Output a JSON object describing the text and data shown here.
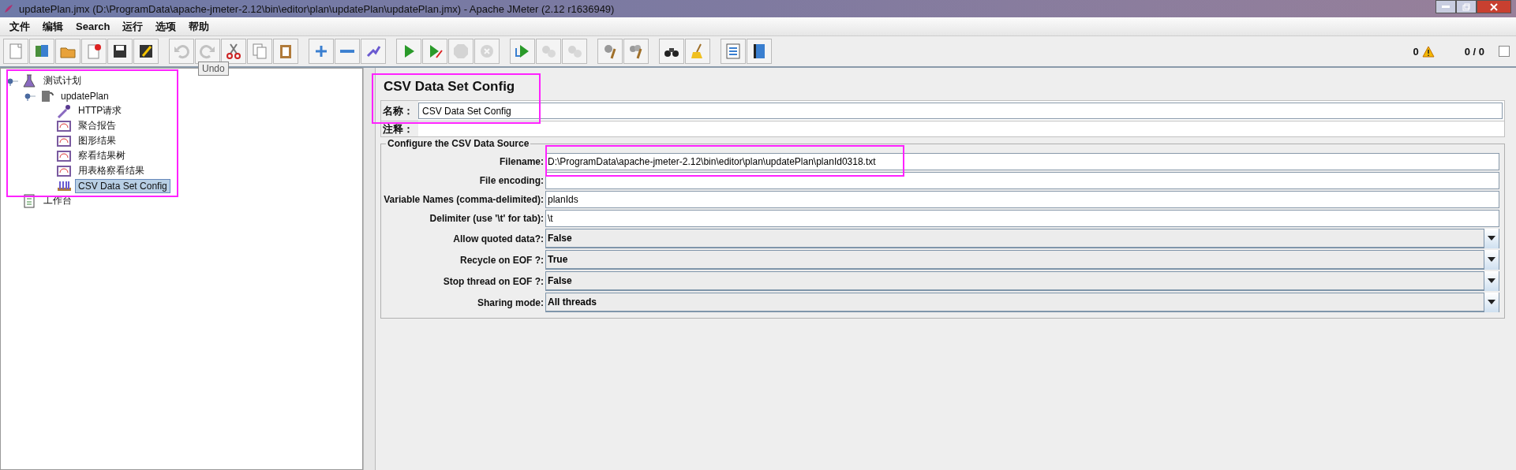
{
  "window": {
    "title": "updatePlan.jmx (D:\\ProgramData\\apache-jmeter-2.12\\bin\\editor\\plan\\updatePlan\\updatePlan.jmx) - Apache JMeter (2.12 r1636949)"
  },
  "menu": [
    "文件",
    "编辑",
    "Search",
    "运行",
    "选项",
    "帮助"
  ],
  "toolbar": [
    [
      {
        "disabled": false
      },
      {
        "disabled": false
      },
      {
        "disabled": false
      },
      {
        "disabled": false
      },
      {
        "disabled": false
      },
      {
        "disabled": false
      }
    ],
    [
      {
        "disabled": true
      },
      {
        "disabled": true
      },
      {
        "disabled": false
      },
      {
        "disabled": false
      },
      {
        "disabled": false
      }
    ],
    [
      {
        "disabled": false
      },
      {
        "disabled": false
      },
      {
        "disabled": false
      }
    ],
    [
      {
        "disabled": false
      },
      {
        "disabled": false
      },
      {
        "disabled": true
      },
      {
        "disabled": true
      }
    ],
    [
      {
        "disabled": false
      },
      {
        "disabled": true
      },
      {
        "disabled": true
      }
    ],
    [
      {
        "disabled": false
      },
      {
        "disabled": false
      }
    ],
    [
      {
        "disabled": false
      },
      {
        "disabled": false
      }
    ],
    [
      {
        "disabled": false
      },
      {
        "disabled": false
      }
    ]
  ],
  "tooltip": "Undo",
  "status": {
    "errors": "0",
    "threads": "0 / 0"
  },
  "tree": [
    {
      "label": "测试计划",
      "kind": "plan",
      "selected": false,
      "expanded": true,
      "children": [
        {
          "label": "updatePlan",
          "kind": "group",
          "selected": false,
          "expanded": true,
          "children": [
            {
              "label": "HTTP请求",
              "kind": "sampler",
              "selected": false
            },
            {
              "label": "聚合报告",
              "kind": "listener",
              "selected": false
            },
            {
              "label": "图形结果",
              "kind": "listener",
              "selected": false
            },
            {
              "label": "察看结果树",
              "kind": "listener",
              "selected": false
            },
            {
              "label": "用表格察看结果",
              "kind": "listener",
              "selected": false
            },
            {
              "label": "CSV Data Set Config",
              "kind": "config",
              "selected": true
            }
          ]
        }
      ]
    },
    {
      "label": "工作台",
      "kind": "workbench",
      "selected": false
    }
  ],
  "form": {
    "title": "CSV Data Set Config",
    "name_label": "名称：",
    "name_value": "CSV Data Set Config",
    "comment_label": "注释：",
    "section": {
      "legend": "Configure the CSV Data Source",
      "fields": [
        {
          "kind": "text",
          "label": "Filename:",
          "value": "D:\\ProgramData\\apache-jmeter-2.12\\bin\\editor\\plan\\updatePlan\\planId0318.txt"
        },
        {
          "kind": "text",
          "label": "File encoding:"
        },
        {
          "kind": "text",
          "label": "Variable Names (comma-delimited):",
          "value": "planIds"
        },
        {
          "kind": "text",
          "label": "Delimiter (use '\\t' for tab):",
          "value": "\\t"
        },
        {
          "kind": "combo",
          "label": "Allow quoted data?:",
          "value": "False"
        },
        {
          "kind": "combo",
          "label": "Recycle on EOF ?:",
          "value": "True"
        },
        {
          "kind": "combo",
          "label": "Stop thread on EOF ?:",
          "value": "False"
        },
        {
          "kind": "combo",
          "label": "Sharing mode:",
          "value": "All threads"
        }
      ]
    }
  }
}
